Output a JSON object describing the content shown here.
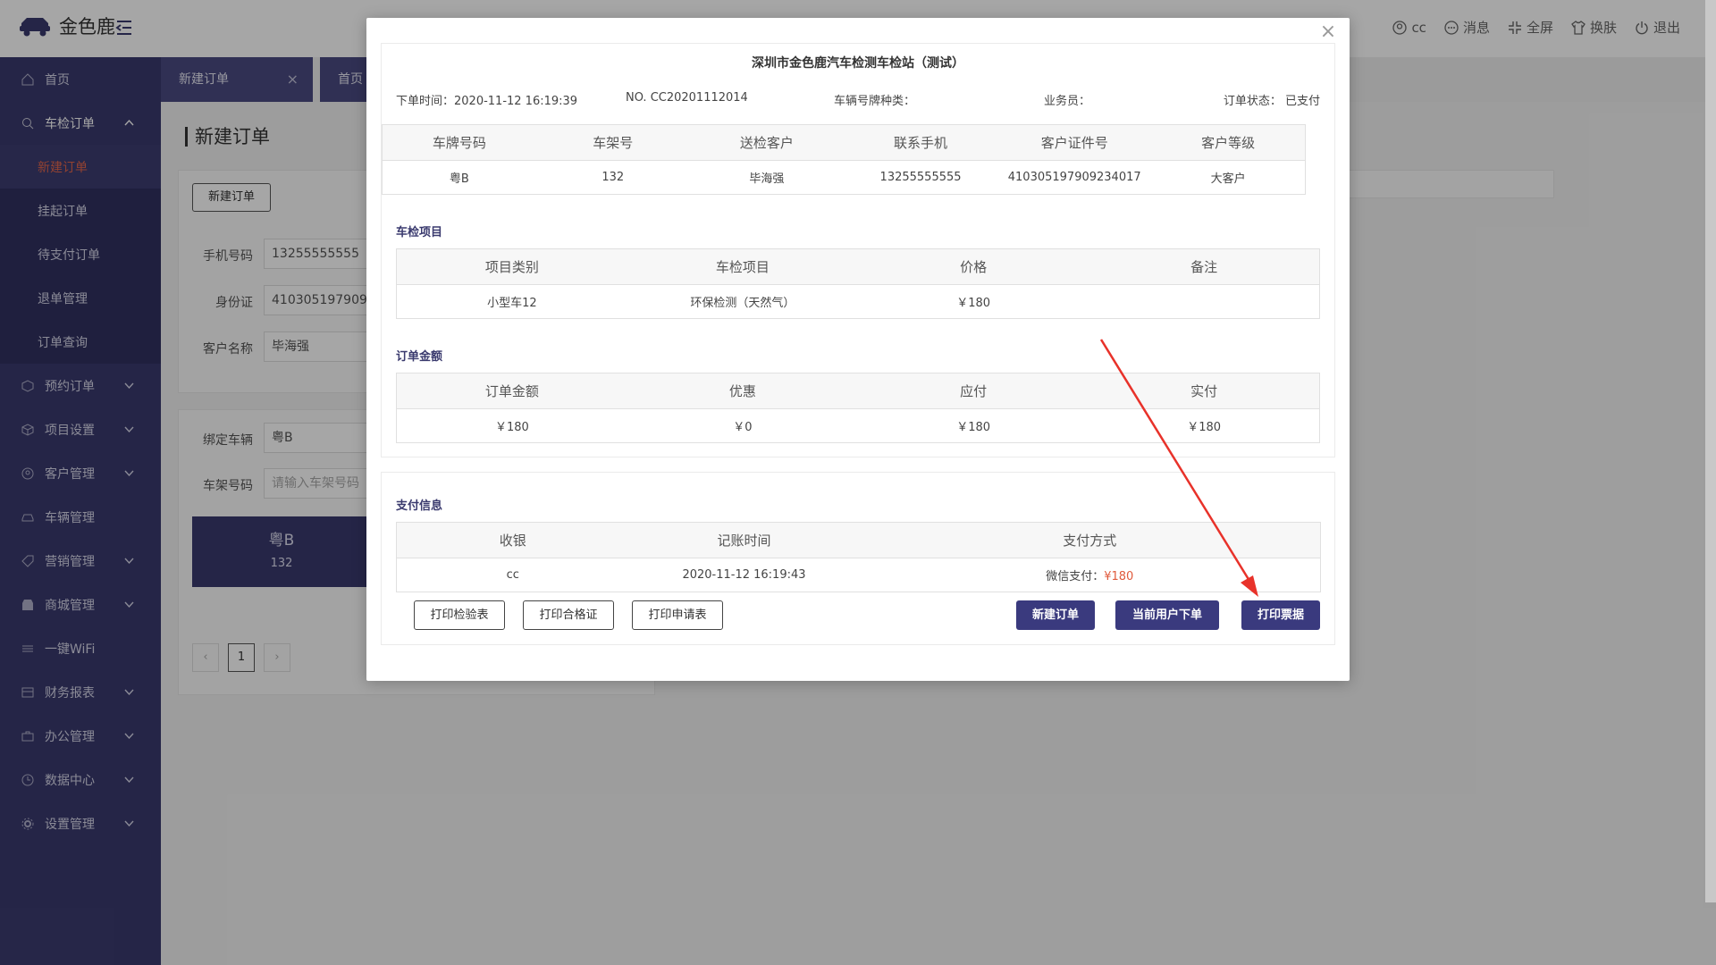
{
  "app": {
    "name": "金色鹿"
  },
  "top_actions": [
    {
      "icon": "user-circle-icon",
      "label": "cc"
    },
    {
      "icon": "message-icon",
      "label": "消息"
    },
    {
      "icon": "fullscreen-icon",
      "label": "全屏"
    },
    {
      "icon": "shirt-icon",
      "label": "换肤"
    },
    {
      "icon": "power-icon",
      "label": "退出"
    }
  ],
  "sidebar": {
    "items": [
      {
        "label": "首页"
      },
      {
        "label": "车检订单"
      },
      {
        "label": "预约订单"
      },
      {
        "label": "项目设置"
      },
      {
        "label": "客户管理"
      },
      {
        "label": "车辆管理"
      },
      {
        "label": "营销管理"
      },
      {
        "label": "商城管理"
      },
      {
        "label": "一键WiFi"
      },
      {
        "label": "财务报表"
      },
      {
        "label": "办公管理"
      },
      {
        "label": "数据中心"
      },
      {
        "label": "设置管理"
      }
    ],
    "sub_items": [
      "新建订单",
      "挂起订单",
      "待支付订单",
      "退单管理",
      "订单查询"
    ]
  },
  "tabs": {
    "active": "新建订单",
    "close": "×",
    "other": "首页"
  },
  "main": {
    "title": "新建订单",
    "new_order_btn": "新建订单",
    "phone_label": "手机号码",
    "phone_value": "13255555555",
    "id_label": "身份证",
    "id_value": "41030519790923",
    "name_label": "客户名称",
    "name_value": "毕海强",
    "bind_label": "绑定车辆",
    "bind_value": "粤B",
    "frame_label": "车架号码",
    "frame_placeholder": "请输入车架号码",
    "car_plate": "粤B",
    "car_frame": "132",
    "pager_prev": "‹",
    "pager_current": "1",
    "pager_next": "›"
  },
  "modal": {
    "close": "×",
    "title": "深圳市金色鹿汽车检测车检站（测试）",
    "meta": {
      "order_time": "下单时间：2020-11-12 16:19:39",
      "order_no": "NO. CC20201112014",
      "plate_type": "车辆号牌种类：",
      "salesman": "业务员：",
      "status": "订单状态： 已支付"
    },
    "customer_table": {
      "headers": [
        "车牌号码",
        "车架号",
        "送检客户",
        "联系手机",
        "客户证件号",
        "客户等级"
      ],
      "rows": [
        [
          "粤B",
          "132",
          "毕海强",
          "13255555555",
          "410305197909234017",
          "大客户"
        ]
      ]
    },
    "items_heading": "车检项目",
    "items_table": {
      "headers": [
        "项目类别",
        "车检项目",
        "价格",
        "备注"
      ],
      "rows": [
        [
          "小型车12",
          "环保检测（天然气）",
          "￥180",
          ""
        ]
      ]
    },
    "amount_heading": "订单金额",
    "amount_table": {
      "headers": [
        "订单金额",
        "优惠",
        "应付",
        "实付"
      ],
      "rows": [
        [
          "￥180",
          "￥0",
          "￥180",
          "￥180"
        ]
      ]
    },
    "payment_heading": "支付信息",
    "payment_table": {
      "headers": [
        "收银",
        "记账时间",
        "支付方式"
      ],
      "cashier": "cc",
      "time": "2020-11-12 16:19:43",
      "method_label": "微信支付：",
      "method_amount": "¥180"
    },
    "buttons": {
      "print_inspection": "打印检验表",
      "print_certificate": "打印合格证",
      "print_application": "打印申请表",
      "new_order": "新建订单",
      "current_user_order": "当前用户下单",
      "print_receipt": "打印票据"
    }
  },
  "colors": {
    "sidebar": "#3a3a6e",
    "primary_button": "#3a3a7e",
    "active_menu_text": "#e0664c",
    "annotation_arrow": "#e8322a"
  }
}
